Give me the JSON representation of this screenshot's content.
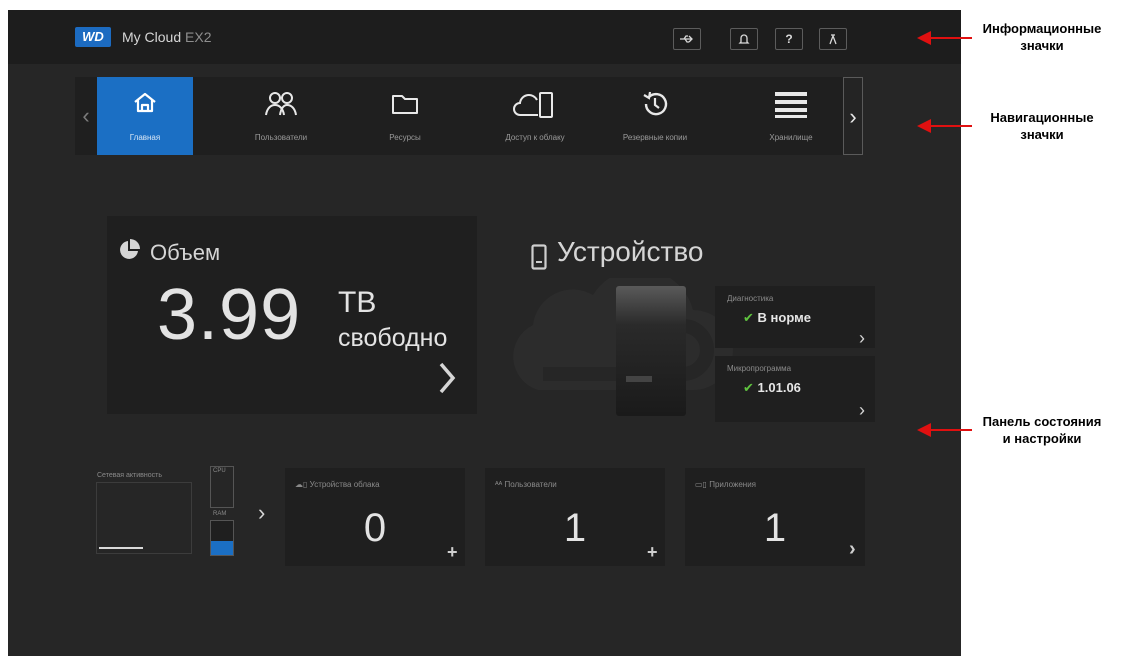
{
  "header": {
    "logo": "WD",
    "title": "My Cloud",
    "title_suffix": "EX2"
  },
  "nav": {
    "items": [
      {
        "label": "Главная",
        "icon": "home-icon"
      },
      {
        "label": "Пользователи",
        "icon": "users-icon"
      },
      {
        "label": "Ресурсы",
        "icon": "folder-icon"
      },
      {
        "label": "Доступ к облаку",
        "icon": "cloud-device-icon"
      },
      {
        "label": "Резервные копии",
        "icon": "history-icon"
      },
      {
        "label": "Хранилище",
        "icon": "storage-icon"
      }
    ],
    "active": "Главная"
  },
  "capacity": {
    "title": "Объем",
    "value": "3.99",
    "unit": "TB",
    "free_label": "свободно"
  },
  "device": {
    "title": "Устройство",
    "diagnostics_label": "Диагностика",
    "diagnostics_value": "В норме",
    "firmware_label": "Микропрограмма",
    "firmware_value": "1.01.06"
  },
  "activity": {
    "label": "Сетевая активность",
    "cpu_label": "CPU",
    "ram_label": "RAM",
    "ram_level": 0.4
  },
  "tiles": [
    {
      "label": "Устройства облака",
      "value": "0",
      "action": "+"
    },
    {
      "label": "Пользователи",
      "value": "1",
      "action": "+"
    },
    {
      "label": "Приложения",
      "value": "1",
      "action": "›"
    }
  ],
  "annotations": {
    "info_icons": [
      "Информационные",
      "значки"
    ],
    "nav_icons": [
      "Навигационные",
      "значки"
    ],
    "status_panel": [
      "Панель состояния",
      "и настройки"
    ]
  },
  "colors": {
    "accent": "#1b6fc4",
    "ok": "#5fc43f",
    "arrow": "#e01010"
  }
}
